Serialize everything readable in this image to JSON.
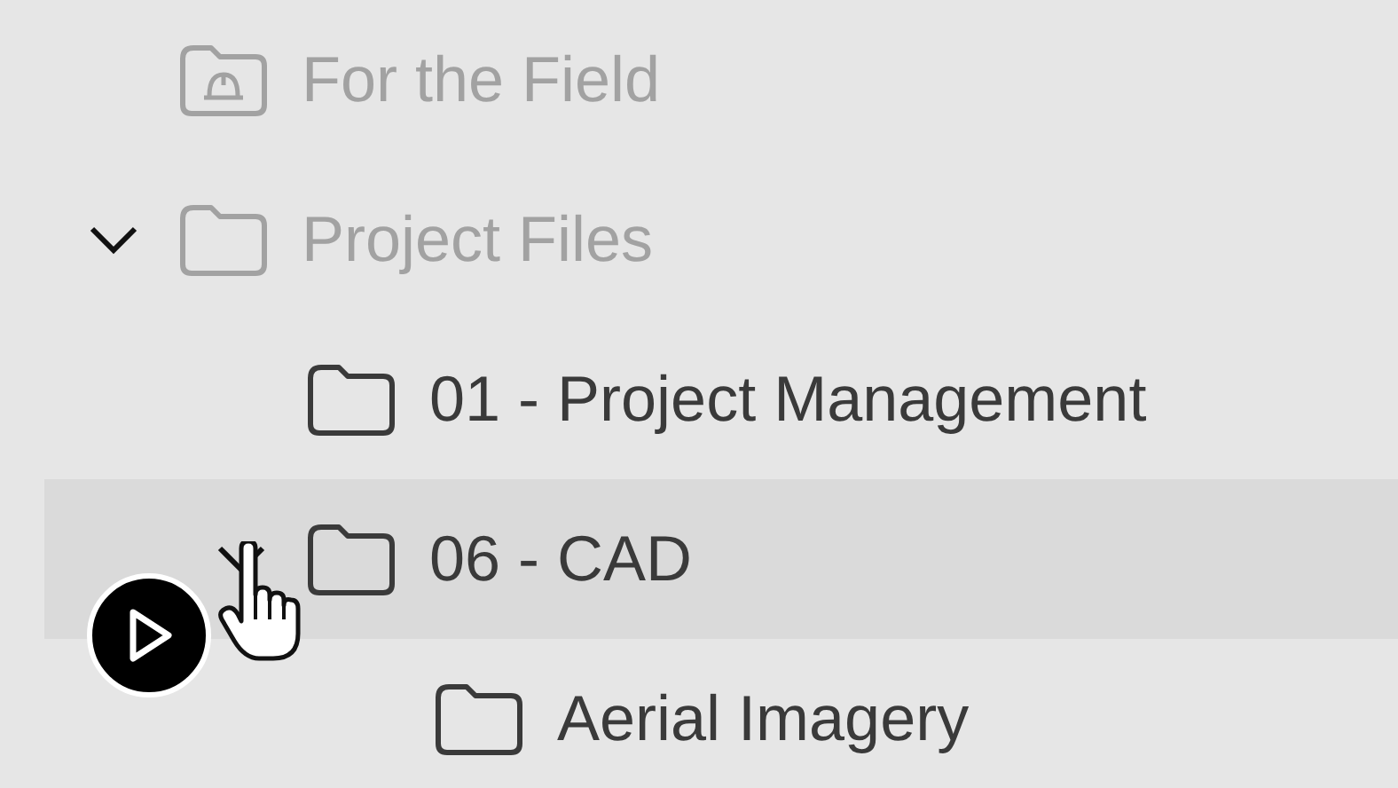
{
  "tree": [
    {
      "label": "For the Field",
      "kind": "hardhat-folder",
      "dimmed": true,
      "selected": false
    },
    {
      "label": "Project Files",
      "kind": "folder",
      "dimmed": true,
      "selected": false,
      "expanded": true,
      "children": [
        {
          "label": "01 - Project Management",
          "kind": "folder",
          "dimmed": false,
          "selected": false
        },
        {
          "label": "06 - CAD",
          "kind": "folder",
          "dimmed": false,
          "selected": true,
          "expanded": true,
          "children": [
            {
              "label": "Aerial Imagery",
              "kind": "folder",
              "dimmed": false,
              "selected": false
            }
          ]
        }
      ]
    }
  ]
}
